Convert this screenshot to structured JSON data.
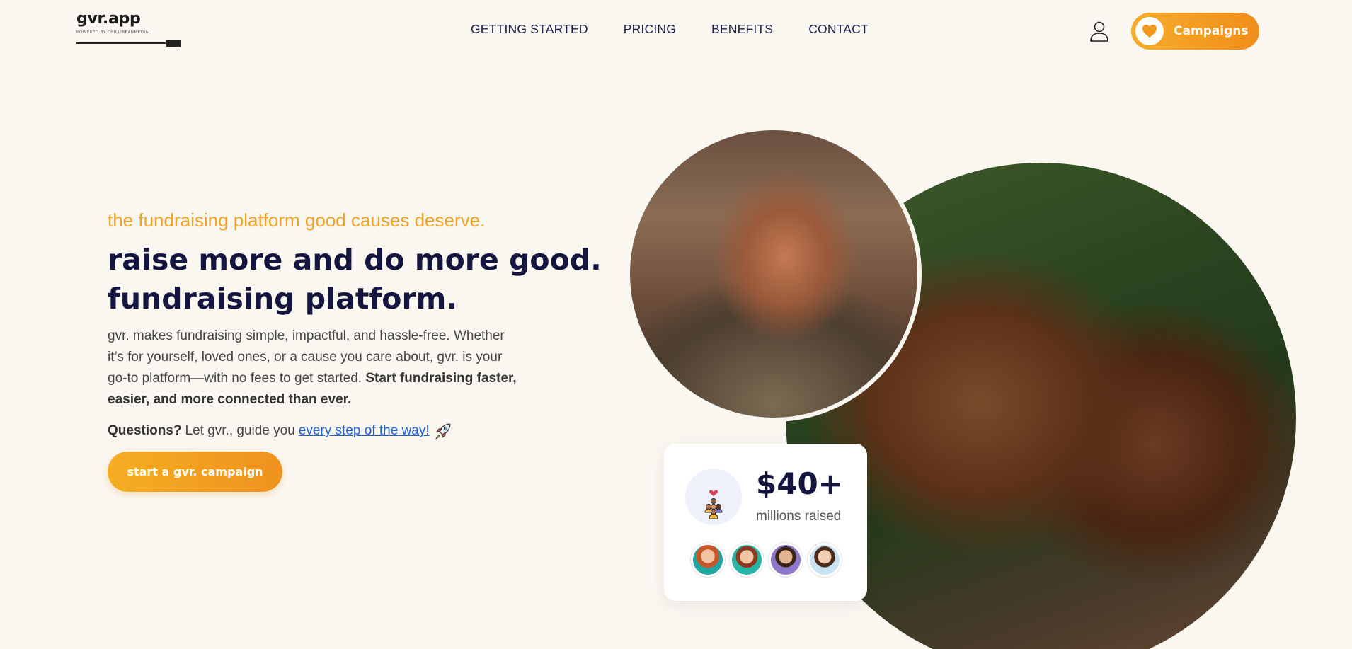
{
  "brand": {
    "name": "gvr.app",
    "sub": "POWERED BY CHILLIBEANMEDIA"
  },
  "nav": {
    "items": [
      {
        "label": "GETTING STARTED"
      },
      {
        "label": "PRICING"
      },
      {
        "label": "BENEFITS"
      },
      {
        "label": "CONTACT"
      }
    ]
  },
  "header": {
    "user_icon": "user-icon",
    "campaigns_label": "Campaigns",
    "campaigns_icon": "heart-icon"
  },
  "hero": {
    "tagline": "the fundraising platform good causes deserve.",
    "headline_line1": "raise more and do more good.",
    "headline_line2": "fundraising platform.",
    "desc_plain": "gvr. makes fundraising simple, impactful, and hassle-free. Whether it’s for yourself, loved ones, or a cause you care about, gvr. is your go-to platform—with no fees to get started.",
    "desc_bold": "Start fundraising faster, easier, and more connected than ever.",
    "questions_bold": "Questions?",
    "questions_text": "Let gvr., guide you",
    "questions_link": "every step of the way!",
    "questions_icon": "rocket-icon",
    "cta_label": "start a gvr. campaign"
  },
  "stats": {
    "value": "$40+",
    "label": "millions raised",
    "icon": "donation-people-icon",
    "avatars": [
      "avatar-1",
      "avatar-2",
      "avatar-3",
      "avatar-4"
    ]
  },
  "colors": {
    "background": "#faf7f1",
    "accent_orange": "#f08d1b",
    "headline_navy": "#141640",
    "link_blue": "#1a5fd6"
  }
}
